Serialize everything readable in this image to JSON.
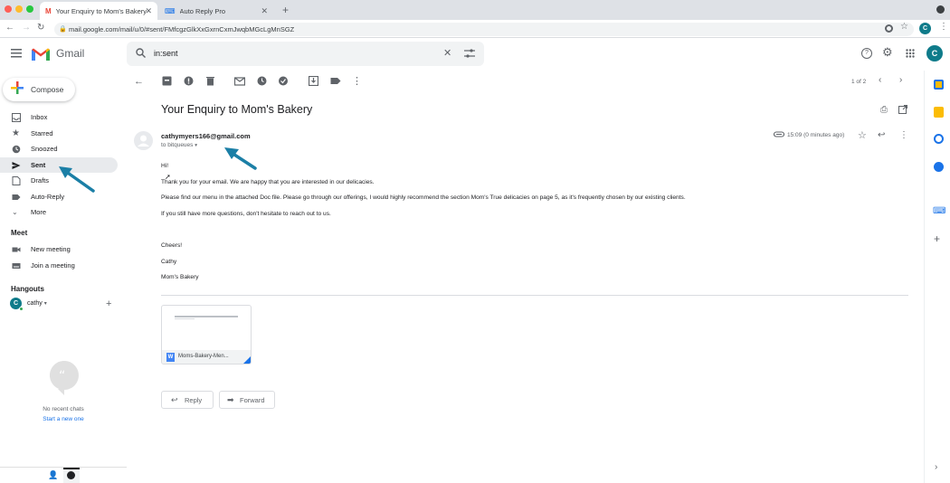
{
  "browser": {
    "tabs": [
      {
        "title": "Your Enquiry to Mom's Bakery",
        "active": true
      },
      {
        "title": "Auto Reply Pro",
        "active": false
      }
    ],
    "url": "mail.google.com/mail/u/0/#sent/FMfcgzGlkXxGxrnCxmJwqbMGcLgMnSGZ",
    "profile_initial": "C"
  },
  "header": {
    "logo_text": "Gmail",
    "search_value": "in:sent",
    "account_initial": "C"
  },
  "sidebar": {
    "compose_label": "Compose",
    "items": [
      {
        "label": "Inbox",
        "icon": "inbox-icon"
      },
      {
        "label": "Starred",
        "icon": "star-icon"
      },
      {
        "label": "Snoozed",
        "icon": "clock-icon"
      },
      {
        "label": "Sent",
        "icon": "send-icon",
        "active": true
      },
      {
        "label": "Drafts",
        "icon": "draft-icon"
      },
      {
        "label": "Auto-Reply",
        "icon": "label-icon"
      },
      {
        "label": "More",
        "icon": "chevron-down-icon"
      }
    ],
    "meet": {
      "title": "Meet",
      "new_meeting": "New meeting",
      "join_meeting": "Join a meeting"
    },
    "hangouts": {
      "title": "Hangouts",
      "user": "cathy",
      "user_initial": "C",
      "no_recent": "No recent chats",
      "start_new": "Start a new one"
    }
  },
  "toolbar": {
    "pagination": "1 of 2"
  },
  "email": {
    "subject": "Your Enquiry to Mom's Bakery",
    "sender": "cathymyers166@gmail.com",
    "to": "to bitqueues",
    "time": "15:09 (0 minutes ago)",
    "body": [
      "Hi!",
      "Thank you for your email. We are happy that you are interested in our delicacies.",
      "Please find our menu in the attached Doc file. Please go through our offerings, I would highly recommend the section Mom's True delicacies on page 5, as it's frequently chosen by our existing clients.",
      "If you still have more questions, don't hesitate to reach out to us.",
      "Cheers!",
      "Cathy",
      "Mom's Bakery"
    ],
    "attachment_name": "Moms-Bakery-Men...",
    "reply_label": "Reply",
    "forward_label": "Forward"
  },
  "colors": {
    "accent_arrow": "#1b7fa6",
    "active_nav": "#e8eaed",
    "profile": "#0f7b8a"
  }
}
